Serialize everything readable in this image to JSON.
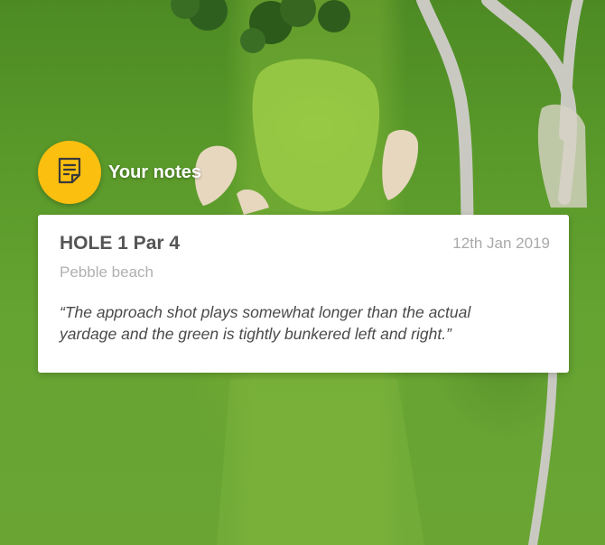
{
  "header": {
    "title": "Your notes",
    "icon": "notes-icon",
    "accent_color": "#fbbf10"
  },
  "note": {
    "hole_title": "HOLE 1 Par 4",
    "date": "12th Jan 2019",
    "course": "Pebble beach",
    "quote": "“The approach shot plays somewhat longer than the actual yardage and the green is tightly bunkered left and right.”"
  }
}
